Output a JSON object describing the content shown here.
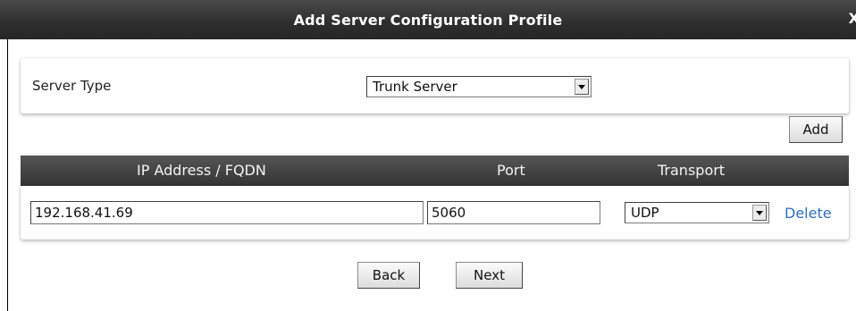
{
  "dialog": {
    "title": "Add Server Configuration Profile",
    "close_label": "X"
  },
  "server_type": {
    "label": "Server Type",
    "selected": "Trunk Server"
  },
  "add_button": "Add",
  "table": {
    "headers": [
      "IP Address / FQDN",
      "Port",
      "Transport"
    ],
    "rows": [
      {
        "ip": "192.168.41.69",
        "port": "5060",
        "transport": "UDP",
        "delete_label": "Delete"
      }
    ]
  },
  "footer": {
    "back_label": "Back",
    "next_label": "Next"
  },
  "colors": {
    "titlebar": "#2f2f2f",
    "table_header": "#444444",
    "link": "#2d6fb8"
  },
  "icons": {
    "dropdown": "chevron-down-icon"
  }
}
